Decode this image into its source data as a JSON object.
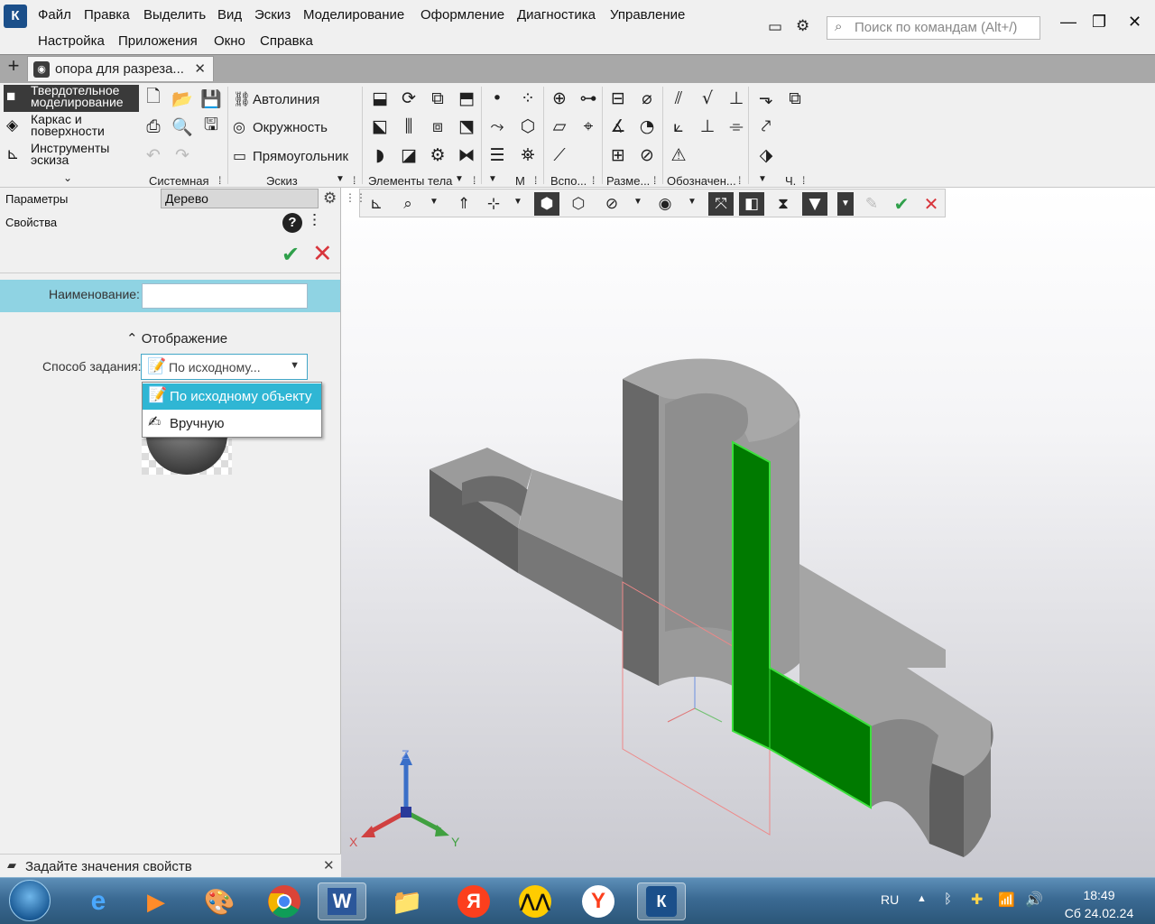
{
  "menu": {
    "row1": [
      "Файл",
      "Правка",
      "Выделить",
      "Вид",
      "Эскиз",
      "Моделирование",
      "Оформление",
      "Диагностика",
      "Управление"
    ],
    "row2": [
      "Настройка",
      "Приложения",
      "Окно",
      "Справка"
    ],
    "search_placeholder": "Поиск по командам (Alt+/)"
  },
  "tab": {
    "title": "опора для разреза...",
    "close": "✕",
    "add": "+"
  },
  "modes": [
    {
      "label": "Твердотельное моделирование",
      "icon": "solid-cube-icon",
      "active": true
    },
    {
      "label": "Каркас и поверхности",
      "icon": "surface-icon",
      "active": false
    },
    {
      "label": "Инструменты эскиза",
      "icon": "sketch-tools-icon",
      "active": false
    }
  ],
  "sketch_items": [
    "Автолиния",
    "Окружность",
    "Прямоугольник"
  ],
  "ribbon_groups": [
    "Системная",
    "Эскиз",
    "Элементы тела",
    "М",
    "Вспо...",
    "Разме...",
    "Обозначен...",
    "Ч."
  ],
  "panel": {
    "params_tab": "Параметры",
    "tree_tab": "Дерево",
    "properties": "Свойства",
    "name_label": "Наименование:",
    "name_value": "",
    "section": "Отображение",
    "method_label": "Способ задания:",
    "method_value": "По исходному...",
    "dropdown_options": [
      "По исходному объекту",
      "Вручную"
    ]
  },
  "status": {
    "text": "Задайте значения свойств"
  },
  "axes": {
    "x": "X",
    "y": "Y",
    "z": "Z"
  },
  "tray": {
    "lang": "RU",
    "time": "18:49",
    "date": "Сб 24.02.24"
  },
  "colors": {
    "accent": "#2fb6d4",
    "section_highlight": "#007a00",
    "section_edge": "#3de03d",
    "ok": "#2fa04b",
    "cancel": "#d8353c"
  }
}
